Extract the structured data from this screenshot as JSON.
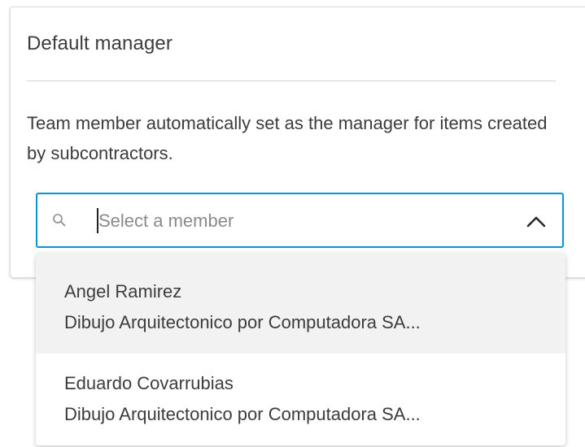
{
  "panel": {
    "title": "Default manager",
    "description": "Team member automatically set as the manager for items created by subcontractors."
  },
  "member_select": {
    "value": "",
    "placeholder": "Select a member",
    "search_icon": "search-icon",
    "toggle_icon": "chevron-up-icon",
    "expanded": true,
    "accent_color": "#0696d7"
  },
  "dropdown": {
    "options": [
      {
        "name": "Angel Ramirez",
        "company": "Dibujo Arquitectonico por Computadora SA..."
      },
      {
        "name": "Eduardo Covarrubias",
        "company": "Dibujo Arquitectonico por Computadora SA..."
      }
    ]
  }
}
